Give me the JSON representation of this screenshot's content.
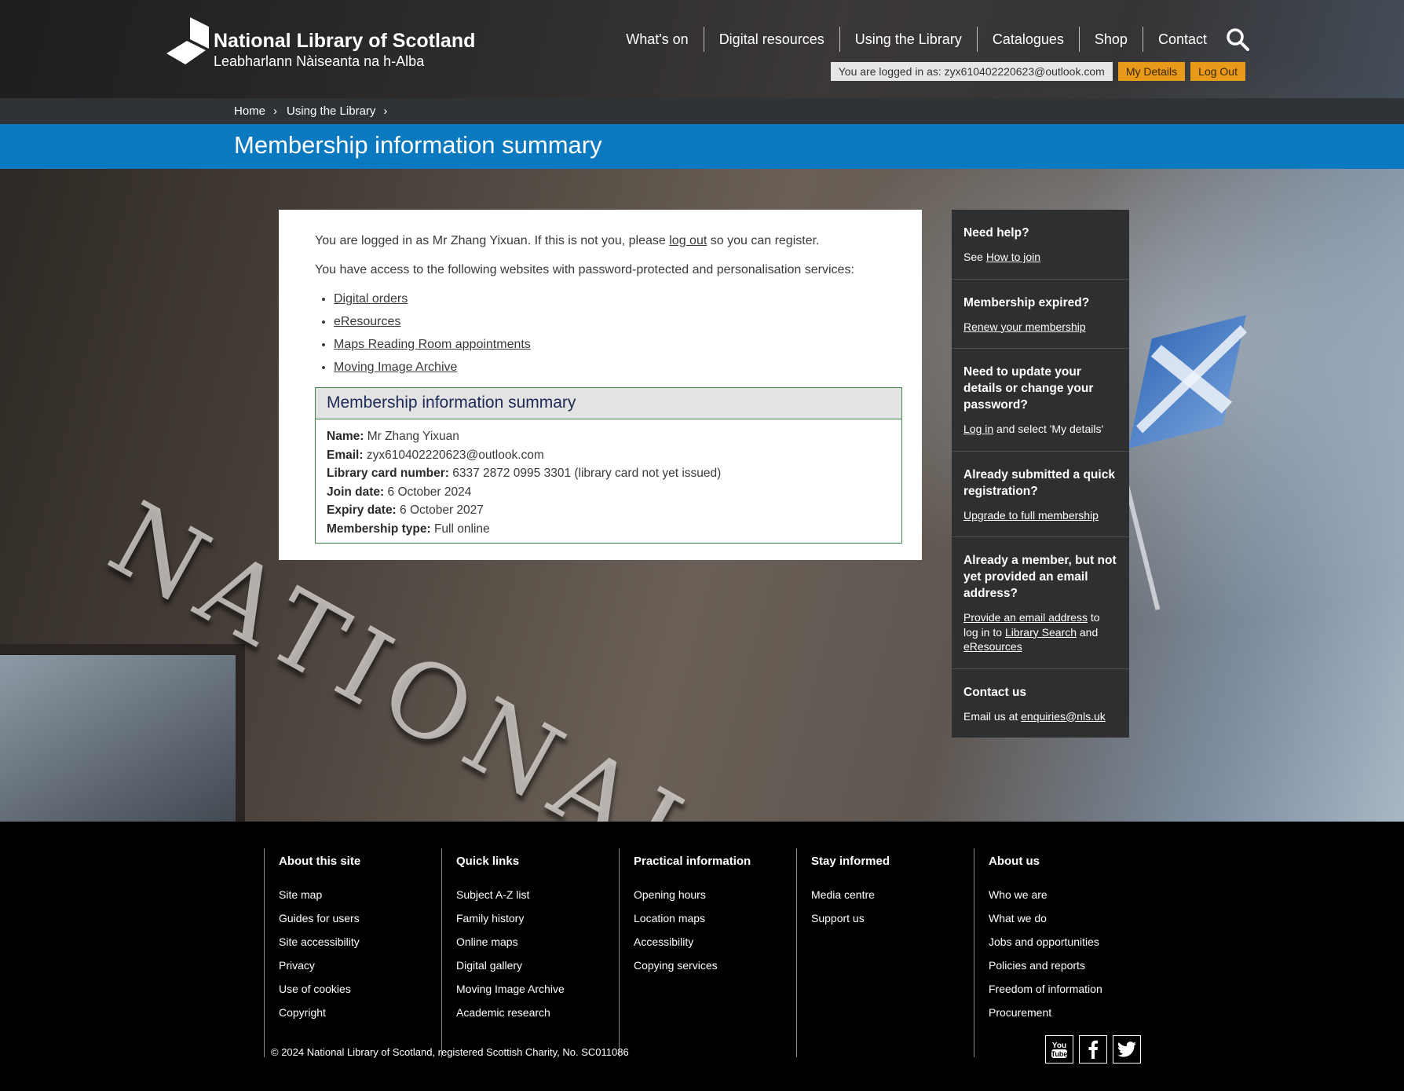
{
  "brand": {
    "title": "National Library of Scotland",
    "subtitle": "Leabharlann Nàiseanta na h-Alba"
  },
  "nav": {
    "items": [
      "What's on",
      "Digital resources",
      "Using the Library",
      "Catalogues",
      "Shop",
      "Contact"
    ]
  },
  "account": {
    "logged_in_text": "You are logged in as: zyx610402220623@outlook.com",
    "my_details": "My Details",
    "log_out": "Log Out"
  },
  "breadcrumb": {
    "home": "Home",
    "section": "Using the Library"
  },
  "page_title": "Membership information summary",
  "hero": {
    "carved_text": "NATIONAL LIB"
  },
  "content": {
    "intro_pre": "You are logged in as Mr Zhang Yixuan. If this is not you, please ",
    "intro_link": "log out",
    "intro_post": " so you can register.",
    "access_text": "You have access to the following websites with password-protected and personalisation services:",
    "sites": [
      "Digital orders",
      "eResources",
      "Maps Reading Room appointments",
      "Moving Image Archive"
    ]
  },
  "summary": {
    "heading": "Membership information summary",
    "rows": [
      {
        "label": "Name:",
        "value": "Mr Zhang Yixuan"
      },
      {
        "label": "Email:",
        "value": "zyx610402220623@outlook.com"
      },
      {
        "label": "Library card number:",
        "value": "6337 2872 0995 3301 (library card not yet issued)"
      },
      {
        "label": "Join date:",
        "value": "6 October 2024"
      },
      {
        "label": "Expiry date:",
        "value": "6 October 2027"
      },
      {
        "label": "Membership type:",
        "value": "Full online"
      }
    ]
  },
  "sidebar": {
    "help": {
      "heading": "Need help?",
      "pre": "See ",
      "link": "How to join"
    },
    "expired": {
      "heading": "Membership expired?",
      "link": "Renew your membership"
    },
    "update": {
      "heading": "Need to update your details or change your password?",
      "link": "Log in",
      "post": " and select 'My details'"
    },
    "quick": {
      "heading": "Already submitted a quick registration?",
      "link": "Upgrade to full membership"
    },
    "member": {
      "heading": "Already a member, but not yet provided an email address?",
      "link1": "Provide an email address",
      "mid1": " to log in to ",
      "link2": "Library Search",
      "mid2": " and ",
      "link3": "eResources"
    },
    "contact": {
      "heading": "Contact us",
      "pre": "Email us at ",
      "link": "enquiries@nls.uk"
    }
  },
  "footer": {
    "columns": [
      {
        "heading": "About this site",
        "links": [
          "Site map",
          "Guides for users",
          "Site accessibility",
          "Privacy",
          "Use of cookies",
          "Copyright"
        ]
      },
      {
        "heading": "Quick links",
        "links": [
          "Subject A-Z list",
          "Family history",
          "Online maps",
          "Digital gallery",
          "Moving Image Archive",
          "Academic research"
        ]
      },
      {
        "heading": "Practical information",
        "links": [
          "Opening hours",
          "Location maps",
          "Accessibility",
          "Copying services"
        ]
      },
      {
        "heading": "Stay informed",
        "links": [
          "Media centre",
          "Support us"
        ]
      },
      {
        "heading": "About us",
        "links": [
          "Who we are",
          "What we do",
          "Jobs and opportunities",
          "Policies and reports",
          "Freedom of information",
          "Procurement"
        ]
      }
    ],
    "copyright": "© 2024 National Library of Scotland, registered Scottish Charity, No. SC011086",
    "social": [
      "youtube-icon",
      "facebook-icon",
      "twitter-icon"
    ]
  },
  "colors": {
    "title_bar": "#0a79bf",
    "account_button": "#e89a1a",
    "summary_border": "#3e8a4a",
    "sidebar_bg": "#2d2f31"
  }
}
